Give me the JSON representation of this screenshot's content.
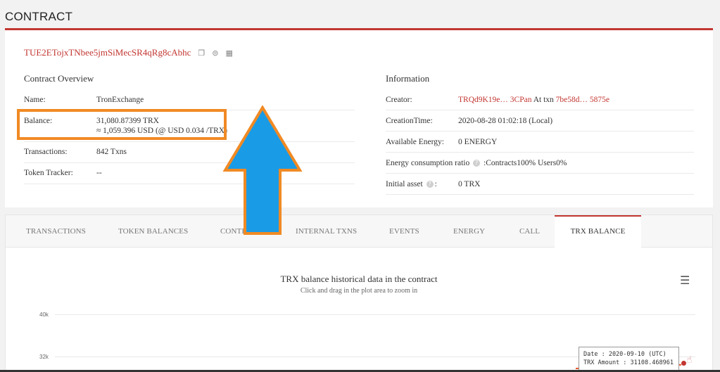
{
  "header": {
    "title": "CONTRACT"
  },
  "contract": {
    "address": "TUE2ETojxTNbee5jmSiMecSR4qRg8cAbhc",
    "icons": [
      "copy-icon",
      "chat-icon",
      "qr-code-icon"
    ]
  },
  "overview": {
    "title": "Contract Overview",
    "name_label": "Name:",
    "name_value": "TronExchange",
    "balance_label": "Balance:",
    "balance_trx": "31,080.87399 TRX",
    "balance_usd": "≈ 1,059.396 USD (@ USD 0.034 /TRX)",
    "transactions_label": "Transactions:",
    "transactions_value": "842  Txns",
    "token_tracker_label": "Token Tracker:",
    "token_tracker_value": "--"
  },
  "information": {
    "title": "Information",
    "creator_label": "Creator:",
    "creator_address": "TRQd9K19e… 3CPan",
    "creator_at": "At txn",
    "creator_txn": "7be58d… 5875e",
    "creation_time_label": "CreationTime:",
    "creation_time_value": "2020-08-28 01:02:18 (Local)",
    "energy_label": "Available Energy:",
    "energy_value": "0  ENERGY",
    "energy_ratio_label": "Energy consumption ratio",
    "energy_ratio_value": ":Contracts100%  Users0%",
    "initial_asset_label": "Initial asset",
    "initial_asset_value": "0 TRX"
  },
  "tabs": [
    {
      "label": "TRANSACTIONS"
    },
    {
      "label": "TOKEN BALANCES"
    },
    {
      "label": "CONTRACT"
    },
    {
      "label": "INTERNAL TXNS"
    },
    {
      "label": "EVENTS"
    },
    {
      "label": "ENERGY"
    },
    {
      "label": "CALL"
    },
    {
      "label": "TRX BALANCE"
    }
  ],
  "active_tab": "TRX BALANCE",
  "chart": {
    "title": "TRX balance historical data in the contract",
    "subtitle": "Click and drag in the plot area to zoom in",
    "menu_icon": "hamburger-menu-icon",
    "y_ticks": [
      "40k",
      "32k"
    ],
    "tooltip_date": "Date : 2020-09-10 (UTC)",
    "tooltip_amount": "TRX Amount : 31108.468961"
  },
  "colors": {
    "accent": "#c23631",
    "highlight_box": "#f08a24",
    "arrow_fill": "#1a9be6",
    "arrow_stroke": "#f08a24"
  }
}
